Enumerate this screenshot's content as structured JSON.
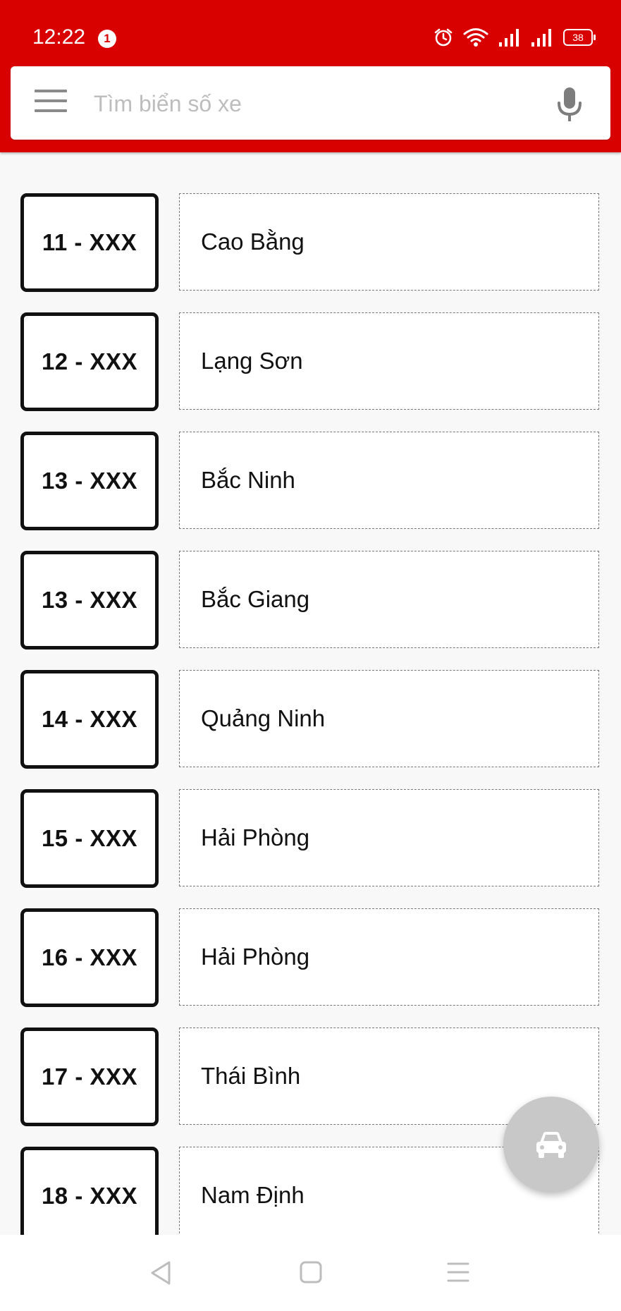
{
  "status_bar": {
    "time": "12:22",
    "notification_count": "1",
    "battery_level": "38"
  },
  "search": {
    "placeholder": "Tìm biển số xe"
  },
  "plates": [
    {
      "code": "11 - XXX",
      "province": "Cao Bằng"
    },
    {
      "code": "12 - XXX",
      "province": "Lạng Sơn"
    },
    {
      "code": "13 - XXX",
      "province": "Bắc Ninh"
    },
    {
      "code": "13 - XXX",
      "province": "Bắc Giang"
    },
    {
      "code": "14 - XXX",
      "province": "Quảng Ninh"
    },
    {
      "code": "15 - XXX",
      "province": "Hải Phòng"
    },
    {
      "code": "16 - XXX",
      "province": "Hải Phòng"
    },
    {
      "code": "17 - XXX",
      "province": "Thái Bình"
    },
    {
      "code": "18 - XXX",
      "province": "Nam Định"
    }
  ],
  "colors": {
    "brand_red": "#d90000",
    "fab_gray": "#c8c8c8"
  },
  "icons": {
    "menu": "menu-icon",
    "mic": "mic-icon",
    "fab": "car-icon"
  }
}
